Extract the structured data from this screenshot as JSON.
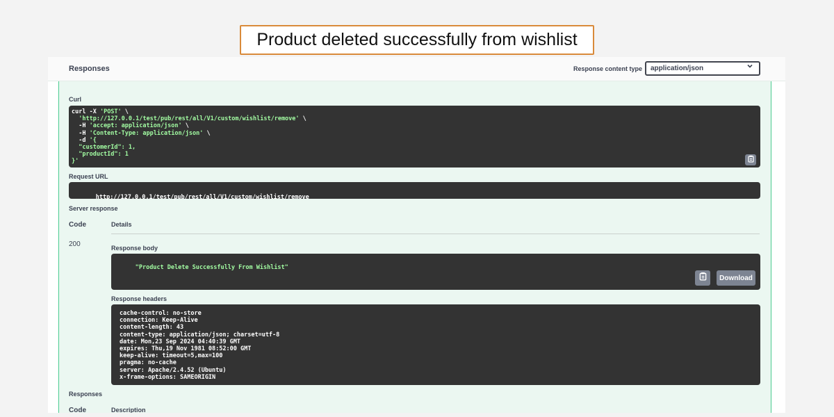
{
  "banner": {
    "text": "Product deleted successfully from wishlist"
  },
  "responses_header": {
    "title": "Responses",
    "content_type_label": "Response content type",
    "content_type_value": "application/json"
  },
  "curl": {
    "label": "Curl",
    "lines": [
      {
        "pre": "curl -X ",
        "str": "'POST'",
        "post": " \\"
      },
      {
        "pre": "  ",
        "str": "'http://127.0.0.1/test/pub/rest/all/V1/custom/wishlist/remove'",
        "post": " \\"
      },
      {
        "pre": "  -H ",
        "str": "'accept: application/json'",
        "post": " \\"
      },
      {
        "pre": "  -H ",
        "str": "'Content-Type: application/json'",
        "post": " \\"
      },
      {
        "pre": "  -d ",
        "str": "'{",
        "post": ""
      },
      {
        "pre": "",
        "str": "  \"customerId\": 1,",
        "post": ""
      },
      {
        "pre": "",
        "str": "  \"productId\": 1",
        "post": ""
      },
      {
        "pre": "",
        "str": "}'",
        "post": ""
      }
    ]
  },
  "request_url": {
    "label": "Request URL",
    "value": "http://127.0.0.1/test/pub/rest/all/V1/custom/wishlist/remove"
  },
  "server_response": {
    "label": "Server response",
    "code_header": "Code",
    "details_header": "Details",
    "code": "200",
    "body_label": "Response body",
    "body": "\"Product Delete Successfully From Wishlist\"",
    "download_label": "Download",
    "headers_label": "Response headers",
    "headers": [
      "cache-control: no-store",
      "connection: Keep-Alive",
      "content-length: 43",
      "content-type: application/json; charset=utf-8",
      "date: Mon,23 Sep 2024 04:40:39 GMT",
      "expires: Thu,19 Nov 1981 08:52:00 GMT",
      "keep-alive: timeout=5,max=100",
      "pragma: no-cache",
      "server: Apache/2.4.52 (Ubuntu)",
      "x-frame-options: SAMEORIGIN"
    ]
  },
  "responses_section": {
    "title": "Responses",
    "code_header": "Code",
    "description_header": "Description"
  }
}
